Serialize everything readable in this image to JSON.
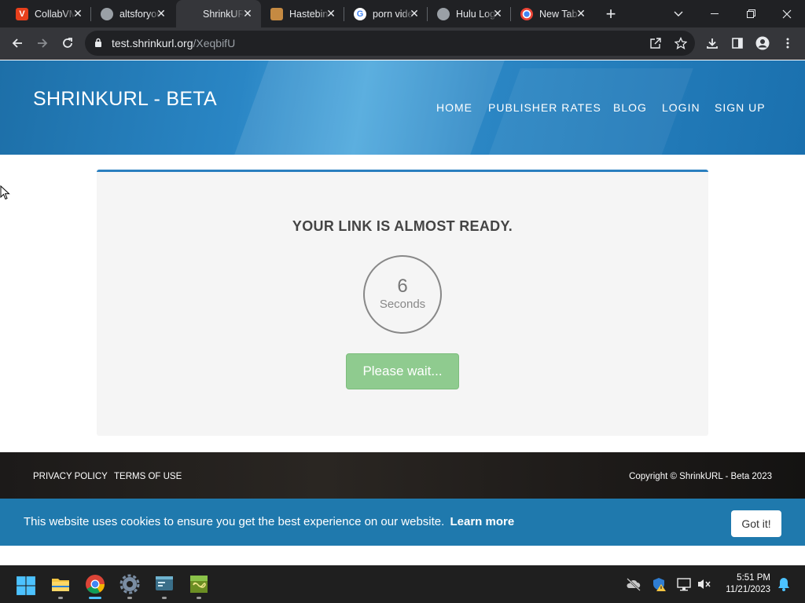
{
  "browser": {
    "tabs": [
      {
        "title": "CollabVM",
        "favicon": "collabvm-icon",
        "color": "#e8401c",
        "active": false
      },
      {
        "title": "altsforyou",
        "favicon": "globe-icon",
        "color": "#5f6368",
        "active": false
      },
      {
        "title": "ShrinkURL",
        "favicon": "",
        "color": "#35363a",
        "active": true
      },
      {
        "title": "Hastebin",
        "favicon": "notepad-icon",
        "color": "#c58a42",
        "active": false
      },
      {
        "title": "porn videos",
        "favicon": "google-icon",
        "color": "#ffffff",
        "active": false
      },
      {
        "title": "Hulu Login",
        "favicon": "globe-icon",
        "color": "#5f6368",
        "active": false
      },
      {
        "title": "New Tab",
        "favicon": "chrome-icon",
        "color": "#ffffff",
        "active": false
      }
    ],
    "url_host": "test.shrinkurl.org",
    "url_path": "/XeqbifU"
  },
  "site": {
    "brand": "SHRINKURL - BETA",
    "nav": [
      "HOME",
      "PUBLISHER RATES",
      "BLOG",
      "LOGIN",
      "SIGN UP"
    ],
    "heading": "YOUR LINK IS ALMOST READY.",
    "countdown_value": "6",
    "countdown_unit": "Seconds",
    "wait_button": "Please wait...",
    "footer_links": [
      "PRIVACY POLICY",
      "TERMS OF USE"
    ],
    "copyright": "Copyright © ShrinkURL - Beta 2023",
    "cookie_message": "This website uses cookies to ensure you get the best experience on our website.",
    "cookie_learn": "Learn more",
    "cookie_button": "Got it!"
  },
  "taskbar": {
    "time": "5:51 PM",
    "date": "11/21/2023",
    "apps": [
      "start-icon",
      "file-explorer-icon",
      "chrome-icon",
      "settings-icon",
      "terminal-icon",
      "minecraft-icon"
    ]
  },
  "colors": {
    "accent": "#2a7fbf",
    "wait_button": "#8fcb8f",
    "cookie_bar": "#1f79ad"
  }
}
